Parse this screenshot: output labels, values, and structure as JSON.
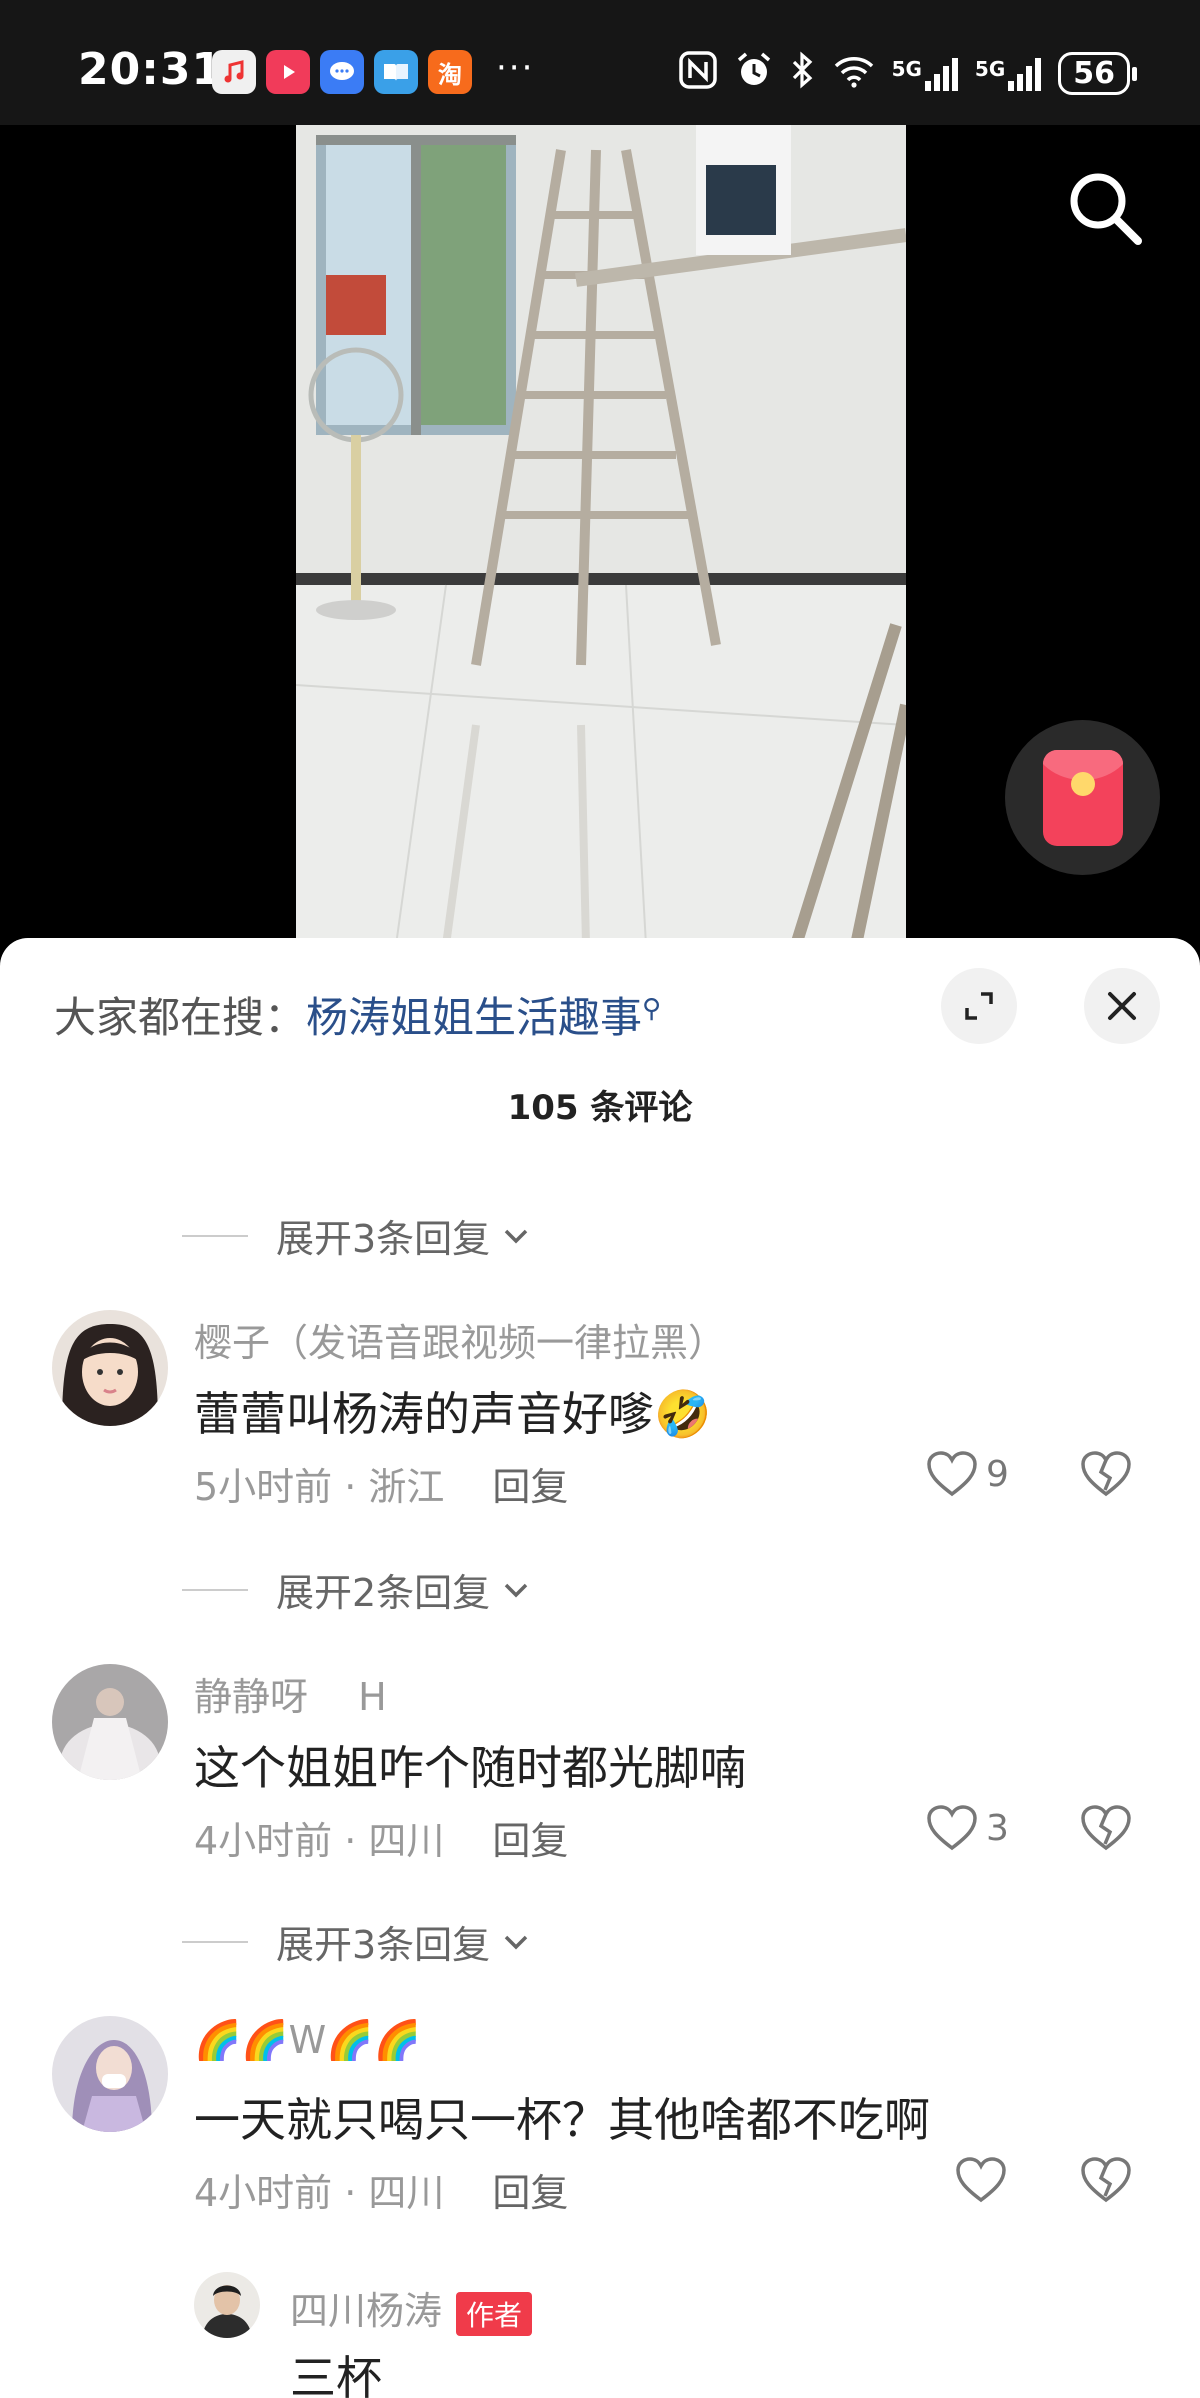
{
  "status_bar": {
    "time": "20:31",
    "more_notifications": "···",
    "network_1": "5G",
    "network_2": "5G",
    "battery": "56",
    "app_icons": [
      "music-app-icon",
      "video-app-icon",
      "message-app-icon",
      "reader-app-icon",
      "taobao-app-icon"
    ],
    "taobao_glyph": "淘"
  },
  "trending": {
    "prefix": "大家都在搜：",
    "keyword": "杨涛姐姐生活趣事",
    "search_glyph": "⚲"
  },
  "comments_header": {
    "count_label": "105 条评论"
  },
  "expand_rows": [
    {
      "label": "展开3条回复"
    },
    {
      "label": "展开2条回复"
    },
    {
      "label": "展开3条回复"
    }
  ],
  "comments": [
    {
      "username": "樱子（发语音跟视频一律拉黑）",
      "text": "蕾蕾叫杨涛的声音好嗲🤣",
      "meta": "5小时前 · 浙江",
      "reply_label": "回复",
      "likes": "9"
    },
    {
      "username": "静静呀　 H",
      "text": "这个姐姐咋个随时都光脚喃",
      "meta": "4小时前 · 四川",
      "reply_label": "回复",
      "likes": "3"
    },
    {
      "username": "🌈🌈W🌈🌈",
      "text": "一天就只喝只一杯？其他啥都不吃啊",
      "meta": "4小时前 · 四川",
      "reply_label": "回复",
      "likes": ""
    }
  ],
  "author_reply": {
    "username": "四川杨涛",
    "badge": "作者",
    "text": "三杯"
  },
  "colors": {
    "accent_red": "#f03b4a",
    "keyword_blue": "#2a4f8a",
    "redpacket": "#f3425b"
  }
}
